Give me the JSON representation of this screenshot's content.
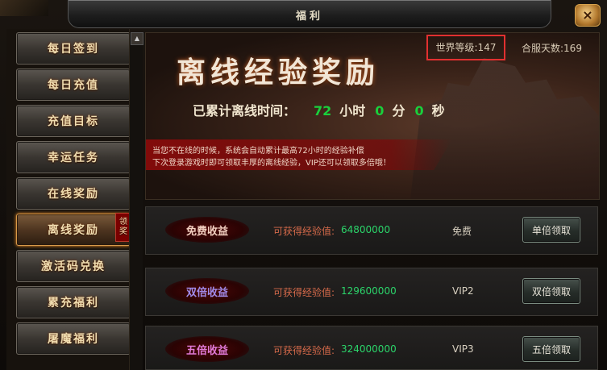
{
  "window": {
    "title": "福利",
    "close_icon": "×"
  },
  "sidebar": {
    "items": [
      {
        "label": "每日签到",
        "active": false
      },
      {
        "label": "每日充值",
        "active": false
      },
      {
        "label": "充值目标",
        "active": false
      },
      {
        "label": "幸运任务",
        "active": false
      },
      {
        "label": "在线奖励",
        "active": false
      },
      {
        "label": "离线奖励",
        "active": true,
        "badge": "领奖"
      },
      {
        "label": "激活码兑换",
        "active": false
      },
      {
        "label": "累充福利",
        "active": false
      },
      {
        "label": "屠魔福利",
        "active": false
      }
    ],
    "scroll_up_icon": "▲"
  },
  "banner": {
    "title": "离线经验奖励",
    "world_level": "世界等级:147",
    "server_days": "合服天数:169",
    "offline_time_label": "已累计离线时间：",
    "hours": "72",
    "hours_unit": "小时",
    "minutes": "0",
    "minutes_unit": "分",
    "seconds": "0",
    "seconds_unit": "秒",
    "info_line1": "当您不在线的时候，系统会自动累计最高72小时的经验补偿",
    "info_line2": "下次登录游戏时即可领取丰厚的离线经验，VIP还可以领取多倍哦！"
  },
  "rewards": [
    {
      "name": "免费收益",
      "name_color": "#f2cfc0",
      "label": "可获得经验值:",
      "value": "64800000",
      "requirement": "免费",
      "button": "单倍领取"
    },
    {
      "name": "双倍收益",
      "name_color": "#a08ae8",
      "label": "可获得经验值:",
      "value": "129600000",
      "requirement": "VIP2",
      "button": "双倍领取"
    },
    {
      "name": "五倍收益",
      "name_color": "#e07ad8",
      "label": "可获得经验值:",
      "value": "324000000",
      "requirement": "VIP3",
      "button": "五倍领取"
    }
  ],
  "colors": {
    "accent_gold": "#f0ddb0",
    "exp_green": "#2bd46a",
    "time_green": "#19d03c",
    "highlight_red": "#e23030"
  }
}
